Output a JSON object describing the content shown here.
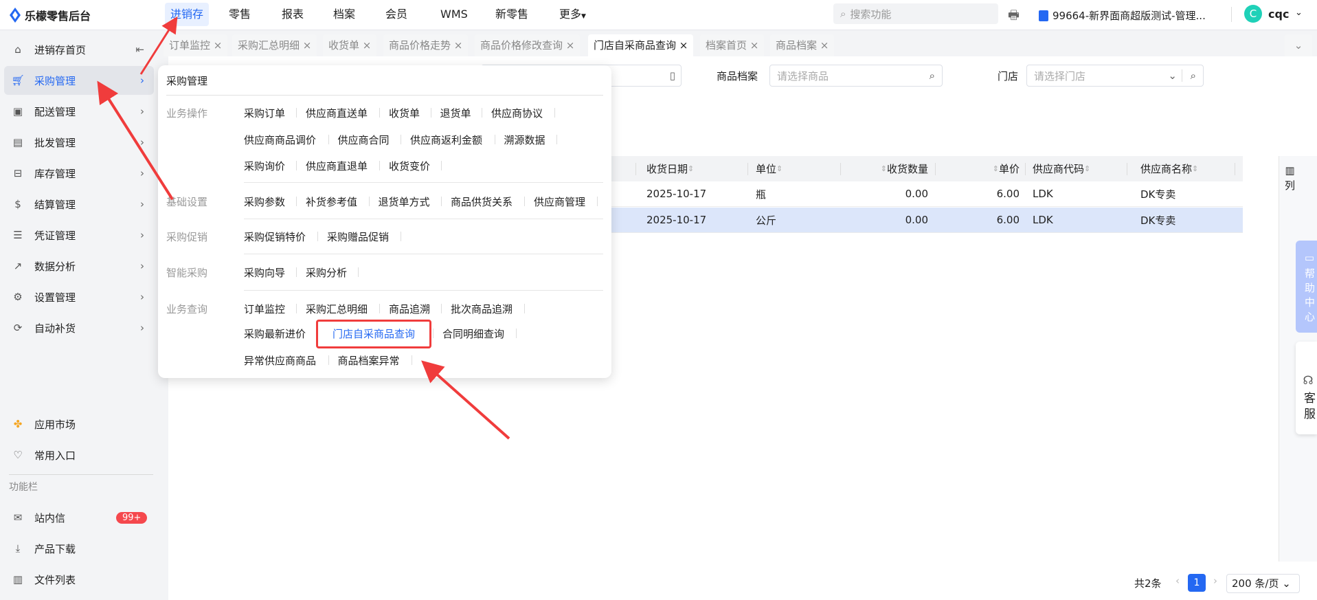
{
  "header": {
    "logo": "乐檬零售后台",
    "nav": [
      "进销存",
      "零售",
      "报表",
      "档案",
      "会员",
      "WMS",
      "新零售",
      "更多"
    ],
    "search_placeholder": "搜索功能",
    "store": "99664-新界面商超版测试-管理...",
    "avatar_letter": "C",
    "user": "cqc"
  },
  "sidebar": {
    "items": [
      "进销存首页",
      "采购管理",
      "配送管理",
      "批发管理",
      "库存管理",
      "结算管理",
      "凭证管理",
      "数据分析",
      "设置管理",
      "自动补货"
    ],
    "app_market": "应用市场",
    "favorites": "常用入口",
    "section": "功能栏",
    "messages": "站内信",
    "badge": "99+",
    "download": "产品下载",
    "files": "文件列表"
  },
  "tabs": [
    "订单监控",
    "采购汇总明细",
    "收货单",
    "商品价格走势",
    "商品价格修改查询",
    "门店自采商品查询",
    "档案首页",
    "商品档案"
  ],
  "filters": {
    "product_label": "商品档案",
    "product_placeholder": "请选择商品",
    "store_label": "门店",
    "store_placeholder": "请选择门店"
  },
  "table": {
    "headers": [
      "收货日期",
      "单位",
      "收货数量",
      "单价",
      "供应商代码",
      "供应商名称"
    ],
    "rows": [
      [
        "2025-10-17",
        "瓶",
        "0.00",
        "6.00",
        "LDK",
        "DK专卖"
      ],
      [
        "2025-10-17",
        "公斤",
        "0.00",
        "6.00",
        "LDK",
        "DK专卖"
      ]
    ],
    "columns_btn": "列"
  },
  "pagination": {
    "total": "共2条",
    "page": "1",
    "page_size": "200 条/页"
  },
  "float": {
    "help": "帮助中心",
    "service": "客服"
  },
  "popup": {
    "title": "采购管理",
    "sections": [
      {
        "label": "业务操作",
        "rows": [
          [
            "采购订单",
            "供应商直送单",
            "收货单",
            "退货单",
            "供应商协议"
          ],
          [
            "供应商商品调价",
            "供应商合同",
            "供应商返利金额",
            "溯源数据"
          ],
          [
            "采购询价",
            "供应商直退单",
            "收货变价"
          ]
        ]
      },
      {
        "label": "基础设置",
        "rows": [
          [
            "采购参数",
            "补货参考值",
            "退货单方式",
            "商品供货关系",
            "供应商管理"
          ]
        ]
      },
      {
        "label": "采购促销",
        "rows": [
          [
            "采购促销特价",
            "采购赠品促销"
          ]
        ]
      },
      {
        "label": "智能采购",
        "rows": [
          [
            "采购向导",
            "采购分析"
          ]
        ]
      },
      {
        "label": "业务查询",
        "rows": [
          [
            "订单监控",
            "采购汇总明细",
            "商品追溯",
            "批次商品追溯"
          ],
          [
            "采购最新进价",
            "门店自采商品查询",
            "合同明细查询"
          ],
          [
            "异常供应商商品",
            "商品档案异常"
          ]
        ]
      }
    ]
  },
  "colors": {
    "accent": "#2468f2",
    "annotation": "#f03c3c",
    "badge": "#f5484d"
  }
}
